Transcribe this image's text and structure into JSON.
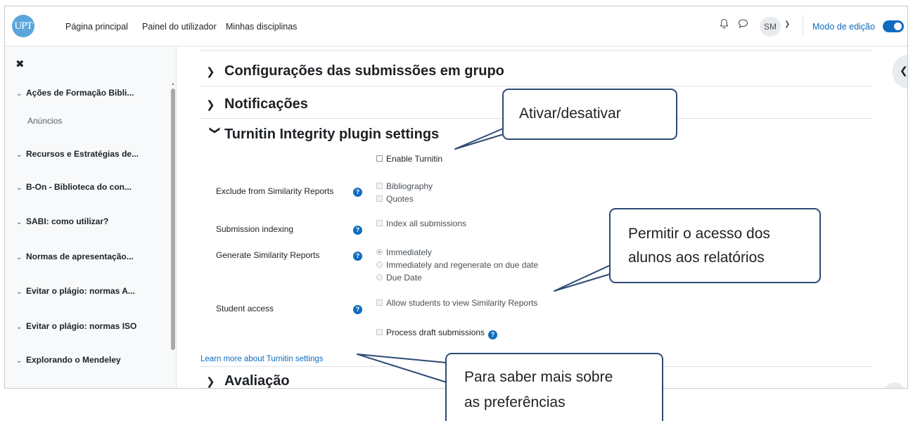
{
  "navbar": {
    "logo_text": "UPT",
    "links": [
      "Página principal",
      "Painel do utilizador",
      "Minhas disciplinas"
    ],
    "avatar_initials": "SM",
    "edit_mode_label": "Modo de edição"
  },
  "sidebar": {
    "items": [
      {
        "label": "Ações de Formação Bibli..."
      },
      {
        "label": "Recursos e Estratégias de..."
      },
      {
        "label": "B-On - Biblioteca do con..."
      },
      {
        "label": "SABI: como utilizar?"
      },
      {
        "label": "Normas de apresentação..."
      },
      {
        "label": "Evitar o plágio: normas A..."
      },
      {
        "label": "Evitar o plágio: normas ISO"
      },
      {
        "label": "Explorando o Mendeley"
      }
    ],
    "subitem": "Anúncios"
  },
  "main": {
    "sections": {
      "group_submissions": "Configurações das submissões em grupo",
      "notifications": "Notificações",
      "turnitin": "Turnitin Integrity plugin settings",
      "evaluation": "Avaliação"
    },
    "enable_turnitin": "Enable Turnitin",
    "fields": {
      "exclude": {
        "label": "Exclude from Similarity Reports",
        "options": [
          "Bibliography",
          "Quotes"
        ]
      },
      "indexing": {
        "label": "Submission indexing",
        "options": [
          "Index all submissions"
        ]
      },
      "generate": {
        "label": "Generate Similarity Reports",
        "options": [
          "Immediately",
          "Immediately and regenerate on due date",
          "Due Date"
        ],
        "selected": "Immediately"
      },
      "student_access": {
        "label": "Student access",
        "options": [
          "Allow students to view Similarity Reports"
        ]
      }
    },
    "process_draft": "Process draft submissions",
    "learn_more_link": "Learn more about Turnitin settings"
  },
  "callouts": {
    "toggle": "Ativar/desativar",
    "student_access": [
      "Permitir o acesso dos",
      "alunos aos relatórios"
    ],
    "learn_more": [
      "Para saber mais sobre",
      "as preferências"
    ]
  },
  "colors": {
    "brand_blue": "#0f6cbf",
    "callout_border": "#2e4a74",
    "logo": "#5aa6dc"
  }
}
